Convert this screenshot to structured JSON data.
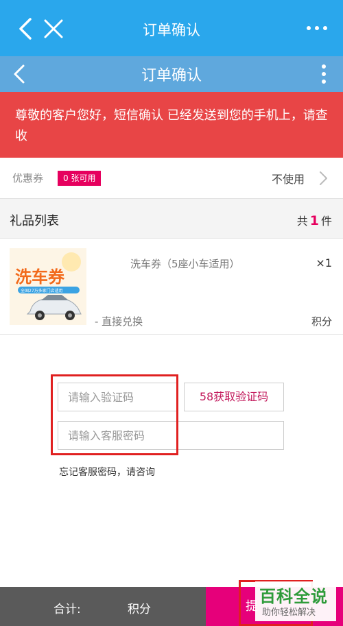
{
  "topbar": {
    "title": "订单确认"
  },
  "subbar": {
    "title": "订单确认"
  },
  "notice": {
    "text": "尊敬的客户您好，短信确认   已经发送到您的手机上，请查收"
  },
  "coupon": {
    "label": "优惠券",
    "badge": "0 张可用",
    "value": "不使用"
  },
  "gift_list": {
    "label": "礼品列表",
    "count_prefix": "共",
    "count": "1",
    "count_suffix": "件"
  },
  "product": {
    "name": "洗车券（5座小车适用）",
    "qty": "×1",
    "method": "- 直接兑换",
    "points": "积分",
    "thumb_title": "洗车券",
    "thumb_subtitle": "全国27万多家门店适用"
  },
  "form": {
    "code_placeholder": "请输入验证码",
    "get_code_label": "58获取验证码",
    "service_pw_placeholder": "请输入客服密码",
    "forgot_text": "忘记客服密码，请咨询"
  },
  "bottombar": {
    "total_label": "合计:",
    "total_value": "积分",
    "submit_label": "提"
  },
  "watermark": {
    "line1": "百科全说",
    "line2": "助你轻松解决"
  },
  "colors": {
    "topbar": "#2aa7ec",
    "subbar": "#5fa8dd",
    "notice": "#e84546",
    "accent": "#e6005e",
    "submit": "#e6007a"
  }
}
